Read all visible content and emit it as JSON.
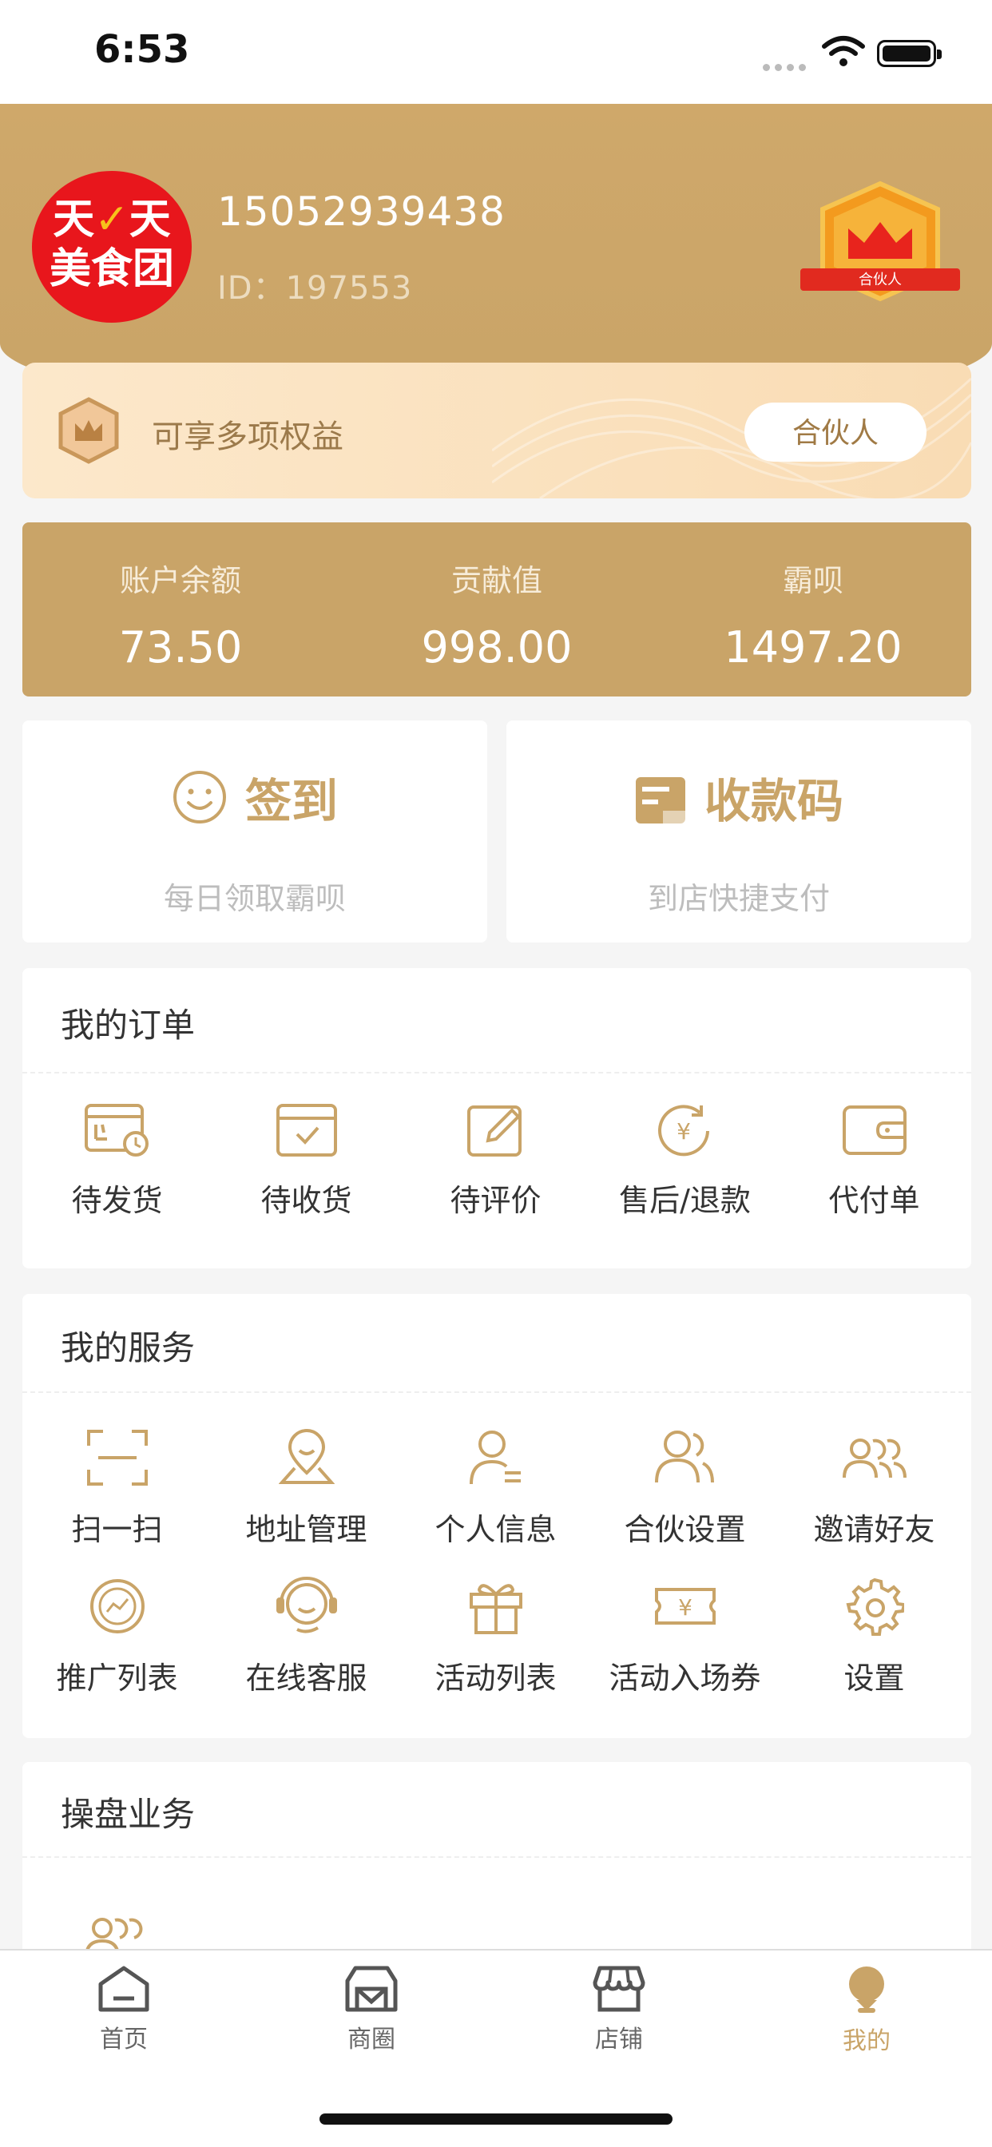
{
  "status_bar": {
    "time": "6:53"
  },
  "profile": {
    "avatar_line1": "天",
    "avatar_check": "✓",
    "avatar_line1b": "天",
    "avatar_line2": "美食团",
    "phone": "15052939438",
    "id_text": "ID：197553",
    "badge_text": "合伙人"
  },
  "benefit": {
    "text": "可享多项权益",
    "button": "合伙人"
  },
  "stats": [
    {
      "label": "账户余额",
      "value": "73.50"
    },
    {
      "label": "贡献值",
      "value": "998.00"
    },
    {
      "label": "霸呗",
      "value": "1497.20"
    }
  ],
  "quick": [
    {
      "title": "签到",
      "sub": "每日领取霸呗",
      "icon": "smile-icon"
    },
    {
      "title": "收款码",
      "sub": "到店快捷支付",
      "icon": "card-icon"
    }
  ],
  "orders": {
    "title": "我的订单",
    "items": [
      "待发货",
      "待收货",
      "待评价",
      "售后/退款",
      "代付单"
    ]
  },
  "services": {
    "title": "我的服务",
    "items": [
      "扫一扫",
      "地址管理",
      "个人信息",
      "合伙设置",
      "邀请好友",
      "推广列表",
      "在线客服",
      "活动列表",
      "活动入场券",
      "设置"
    ]
  },
  "trading": {
    "title": "操盘业务"
  },
  "tabs": [
    "首页",
    "商圈",
    "店铺",
    "我的"
  ],
  "colors": {
    "brand": "#c9a468",
    "avatar_red": "#e8161c"
  }
}
